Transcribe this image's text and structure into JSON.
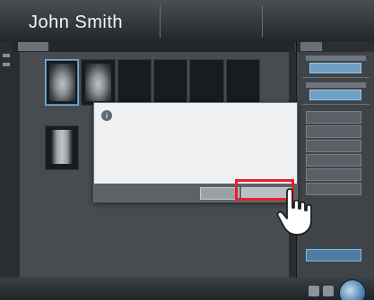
{
  "header": {
    "patient_name": "John Smith",
    "info_a": "",
    "info_b": ""
  },
  "tabs": [
    "",
    "",
    ""
  ],
  "right_panel": {
    "tabs": [
      "",
      "",
      ""
    ]
  },
  "dialog": {
    "message": "",
    "cancel_label": "",
    "ok_label": ""
  },
  "colors": {
    "highlight": "#e8202a",
    "accent": "#5aa9e6"
  }
}
